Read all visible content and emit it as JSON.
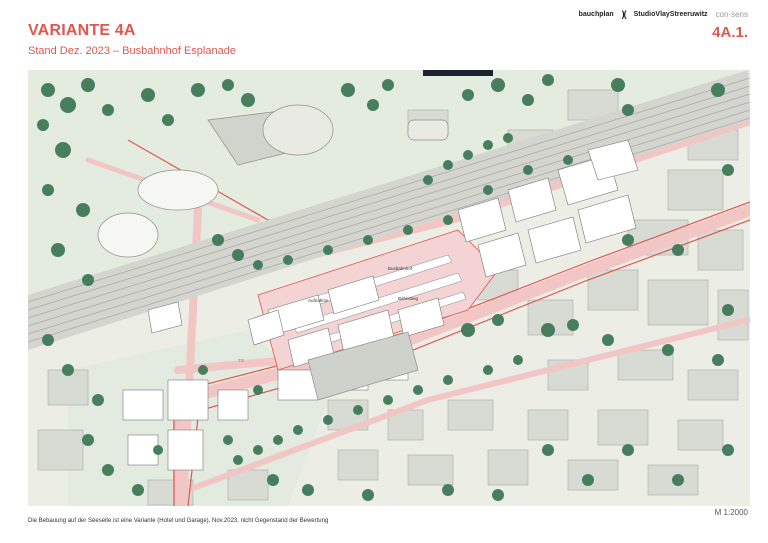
{
  "header": {
    "title": "VARIANTE 4A",
    "subtitle": "Stand Dez. 2023 – Busbahnhof Esplanade",
    "code": "4A.1."
  },
  "logos": {
    "bauchplan": "bauchplan",
    "bauchplan_mark": ")(",
    "studio": "StudioVlayStreeruwitz",
    "consens": "con·sens"
  },
  "map": {
    "labels": {
      "stadtkapellm": "Busbahnhof",
      "aufnahme": "Aufnahme",
      "bahnsteig": "Bahnsteig",
      "tg": "TG"
    }
  },
  "footer": {
    "scale": "M 1:2000",
    "note": "Die Bebauung auf der Seeseite ist eine Variante (Hotel und Garage), Nov.2023, nicht Gegenstand der Bewertung"
  },
  "colors": {
    "accent": "#e0574f",
    "tree": "#3f7a57",
    "building_new": "#ffffff",
    "building_existing": "#d6d9d2",
    "road_pink": "#f4cccb",
    "rail": "#bfc0bb"
  }
}
